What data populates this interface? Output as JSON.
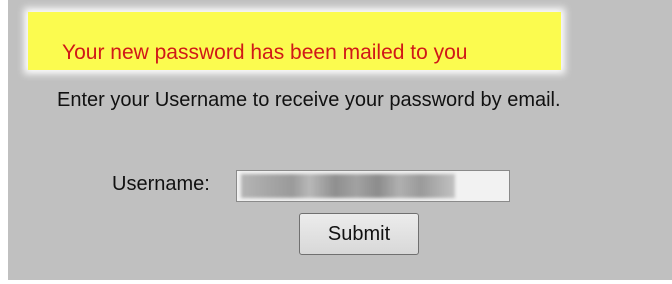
{
  "notice": {
    "message": "Your new password has been mailed to you"
  },
  "instructions": "Enter your Username to receive your password by email.",
  "form": {
    "username_label": "Username:",
    "username_value": "",
    "submit_label": "Submit"
  },
  "colors": {
    "panel_background": "#c0c0c0",
    "notice_background": "#fbfb4f",
    "notice_text": "#d01818"
  }
}
